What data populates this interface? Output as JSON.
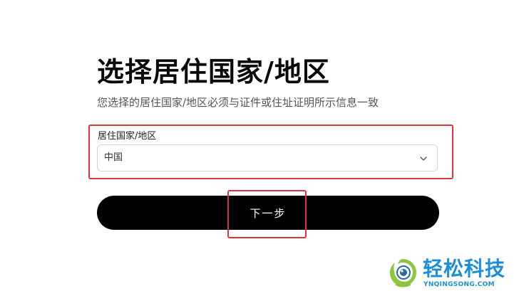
{
  "page": {
    "title": "选择居住国家/地区",
    "subtitle": "您选择的居住国家/地区必须与证件或住址证明所示信息一致"
  },
  "form": {
    "country_label": "居住国家/地区",
    "country_value": "中国"
  },
  "actions": {
    "next_label": "下一步"
  },
  "watermark": {
    "name": "轻松科技",
    "domain": "YNQINGSONG.COM"
  },
  "colors": {
    "button_bg": "#000000",
    "highlight": "#e0343a",
    "watermark": "#1d8fd8"
  },
  "icons": {
    "select_arrow": "chevron-down-icon"
  }
}
